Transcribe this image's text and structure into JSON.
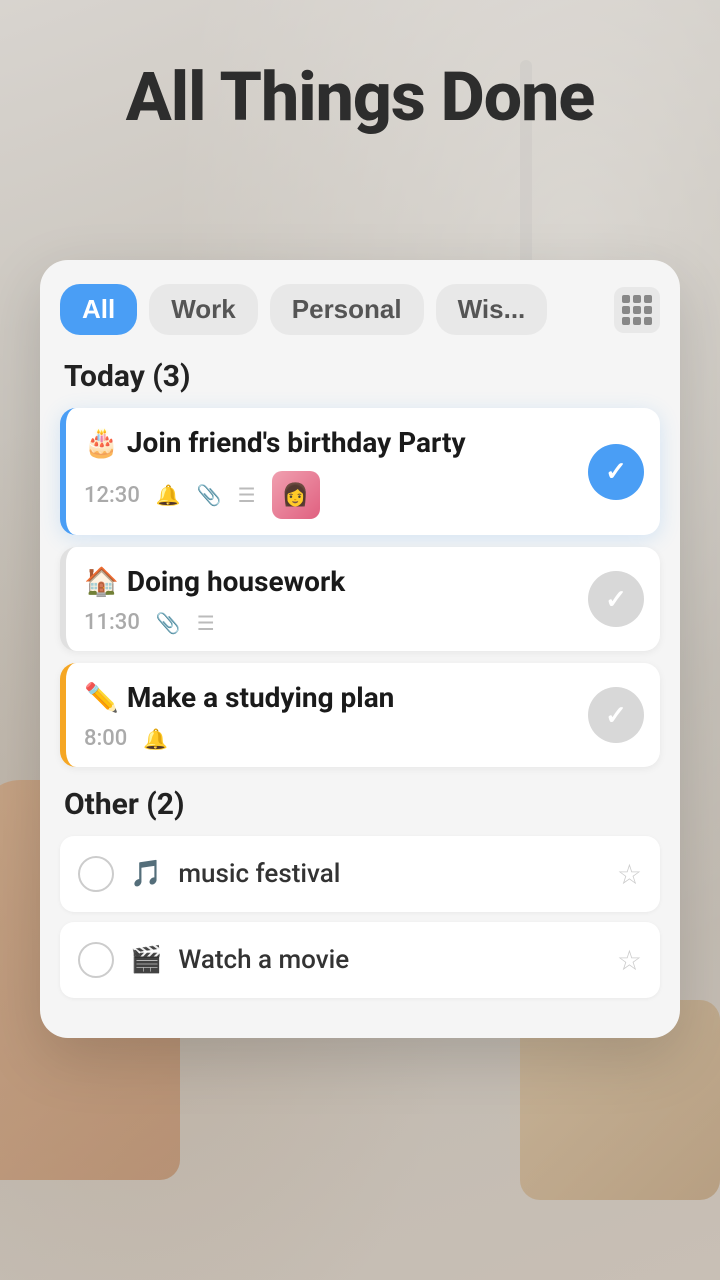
{
  "app": {
    "title": "All Things Done"
  },
  "tabs": {
    "items": [
      {
        "id": "all",
        "label": "All",
        "active": true
      },
      {
        "id": "work",
        "label": "Work",
        "active": false
      },
      {
        "id": "personal",
        "label": "Personal",
        "active": false
      },
      {
        "id": "wishlist",
        "label": "Wis...",
        "active": false
      }
    ]
  },
  "today_section": {
    "header": "Today (3)",
    "tasks": [
      {
        "id": "task-1",
        "emoji": "🎂",
        "title": "Join friend's birthday Party",
        "time": "12:30",
        "has_bell": true,
        "has_attachment": true,
        "has_list": true,
        "has_thumbnail": true,
        "checked": true,
        "accent": "blue"
      },
      {
        "id": "task-2",
        "emoji": "🏠",
        "title": "Doing housework",
        "time": "11:30",
        "has_bell": false,
        "has_attachment": true,
        "has_list": true,
        "has_thumbnail": false,
        "checked": false,
        "accent": "gray"
      },
      {
        "id": "task-3",
        "emoji": "✏️",
        "title": "Make a studying plan",
        "time": "8:00",
        "has_bell": true,
        "has_attachment": false,
        "has_list": false,
        "has_thumbnail": false,
        "checked": false,
        "accent": "orange"
      }
    ]
  },
  "other_section": {
    "header": "Other (2)",
    "items": [
      {
        "id": "other-1",
        "emoji": "🎵",
        "title": "music festival",
        "starred": false
      },
      {
        "id": "other-2",
        "emoji": "🎬",
        "title": "Watch a movie",
        "starred": false
      }
    ]
  }
}
